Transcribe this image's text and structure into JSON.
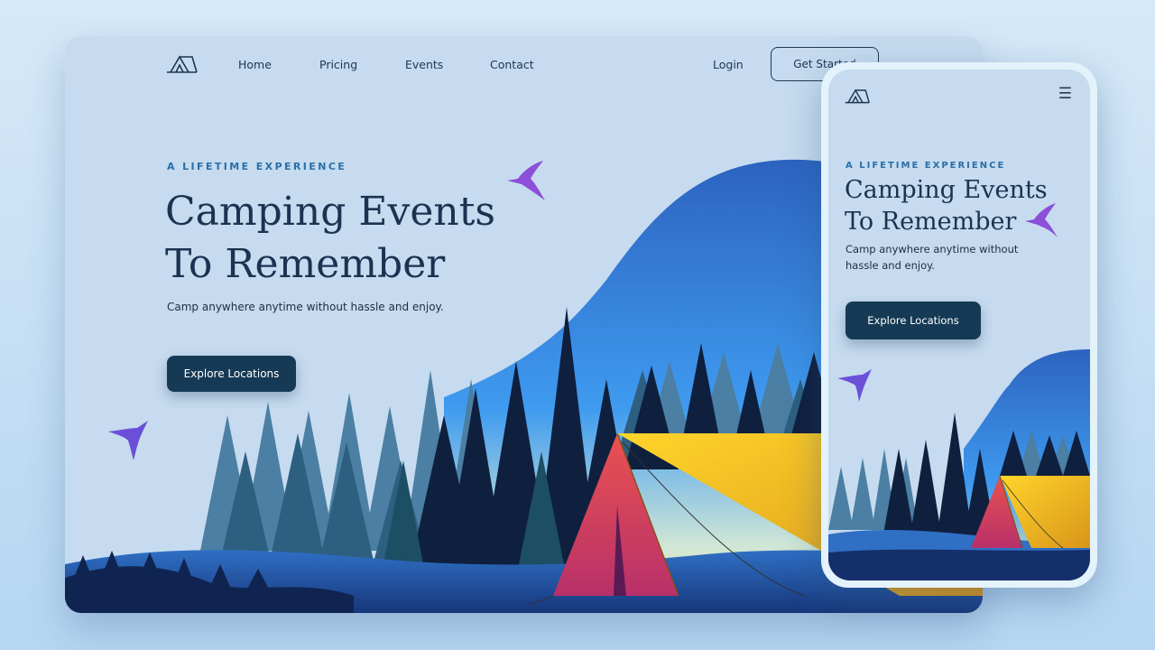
{
  "desktop": {
    "nav": {
      "links": [
        "Home",
        "Pricing",
        "Events",
        "Contact"
      ],
      "login": "Login",
      "cta": "Get Started"
    },
    "hero": {
      "eyebrow": "A LIFETIME EXPERIENCE",
      "title_line1": "Camping Events",
      "title_line2": "To Remember",
      "subtitle": "Camp anywhere anytime without hassle and enjoy.",
      "button": "Explore Locations"
    }
  },
  "mobile": {
    "menu_icon": "hamburger-menu-icon",
    "hero": {
      "eyebrow": "A LIFETIME EXPERIENCE",
      "title_line1": "Camping Events",
      "title_line2": "To Remember",
      "subtitle": "Camp anywhere anytime without hassle and enjoy.",
      "button": "Explore Locations"
    }
  },
  "colors": {
    "background": "#c6dbef",
    "primary": "#163a55",
    "accent": "#2a6ea6",
    "tent_yellow": "#f5c518",
    "tent_red": "#d23a5a",
    "bird": "#8b4fd8"
  },
  "icons": [
    "tent-logo-icon",
    "hummingbird-icon",
    "hamburger-menu-icon"
  ]
}
